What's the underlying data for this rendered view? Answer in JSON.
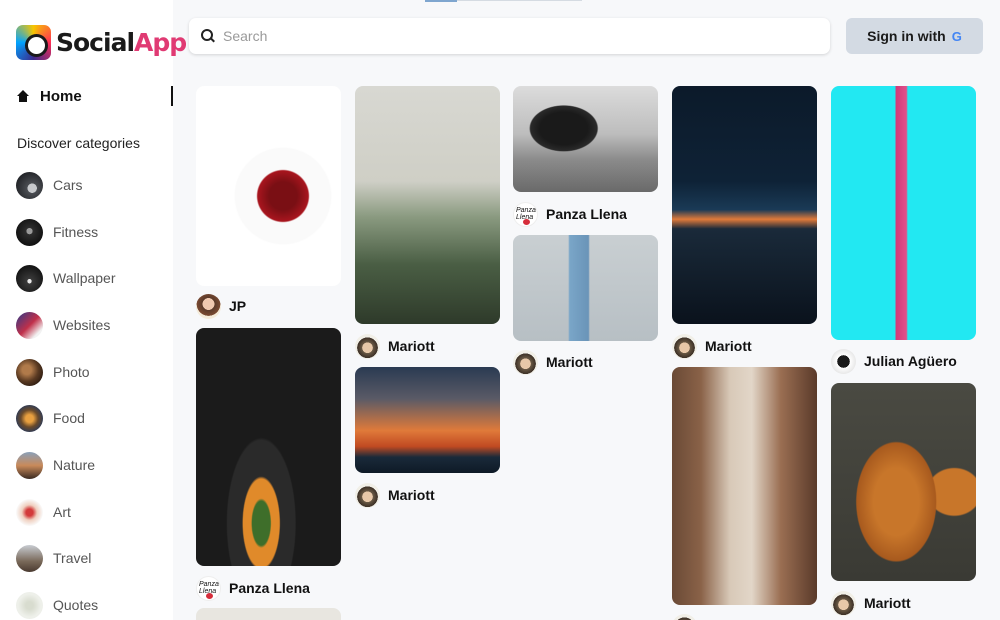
{
  "app": {
    "name_main": "Social",
    "name_accent": "App"
  },
  "nav": {
    "home_label": "Home",
    "discover_heading": "Discover categories"
  },
  "categories": [
    {
      "label": "Cars",
      "thumb": "cars"
    },
    {
      "label": "Fitness",
      "thumb": "fitness"
    },
    {
      "label": "Wallpaper",
      "thumb": "wallpaper"
    },
    {
      "label": "Websites",
      "thumb": "websites"
    },
    {
      "label": "Photo",
      "thumb": "photo"
    },
    {
      "label": "Food",
      "thumb": "food"
    },
    {
      "label": "Nature",
      "thumb": "nature"
    },
    {
      "label": "Art",
      "thumb": "art"
    },
    {
      "label": "Travel",
      "thumb": "travel"
    },
    {
      "label": "Quotes",
      "thumb": "quotes"
    }
  ],
  "search": {
    "placeholder": "Search",
    "value": ""
  },
  "auth": {
    "signin_label": "Sign in with",
    "provider_icon": "google-icon",
    "provider_glyph": "G"
  },
  "pins": [
    {
      "image": "cherries-in-bowl",
      "author": "JP"
    },
    {
      "image": "autumn-pumpkins",
      "author": "Panza Llena"
    },
    {
      "image": "girl-in-field",
      "author": "Mariott"
    },
    {
      "image": "lighthouse-sunset",
      "author": "Mariott"
    },
    {
      "image": "horse-black-and-white",
      "author": "Panza Llena"
    },
    {
      "image": "skateboarder-legs",
      "author": "Mariott"
    },
    {
      "image": "beach-silhouette-dusk",
      "author": "Mariott"
    },
    {
      "image": "canyon-hiker",
      "author": ""
    },
    {
      "image": "pink-flower-cyan",
      "author": "Julian Agüero"
    },
    {
      "image": "shiba-inu-dogs",
      "author": "Mariott"
    }
  ],
  "colors": {
    "accent": "#e03a73",
    "signin_bg": "#d3dae3",
    "sidebar_bg": "#ffffff",
    "page_bg": "#f7f8fa"
  }
}
